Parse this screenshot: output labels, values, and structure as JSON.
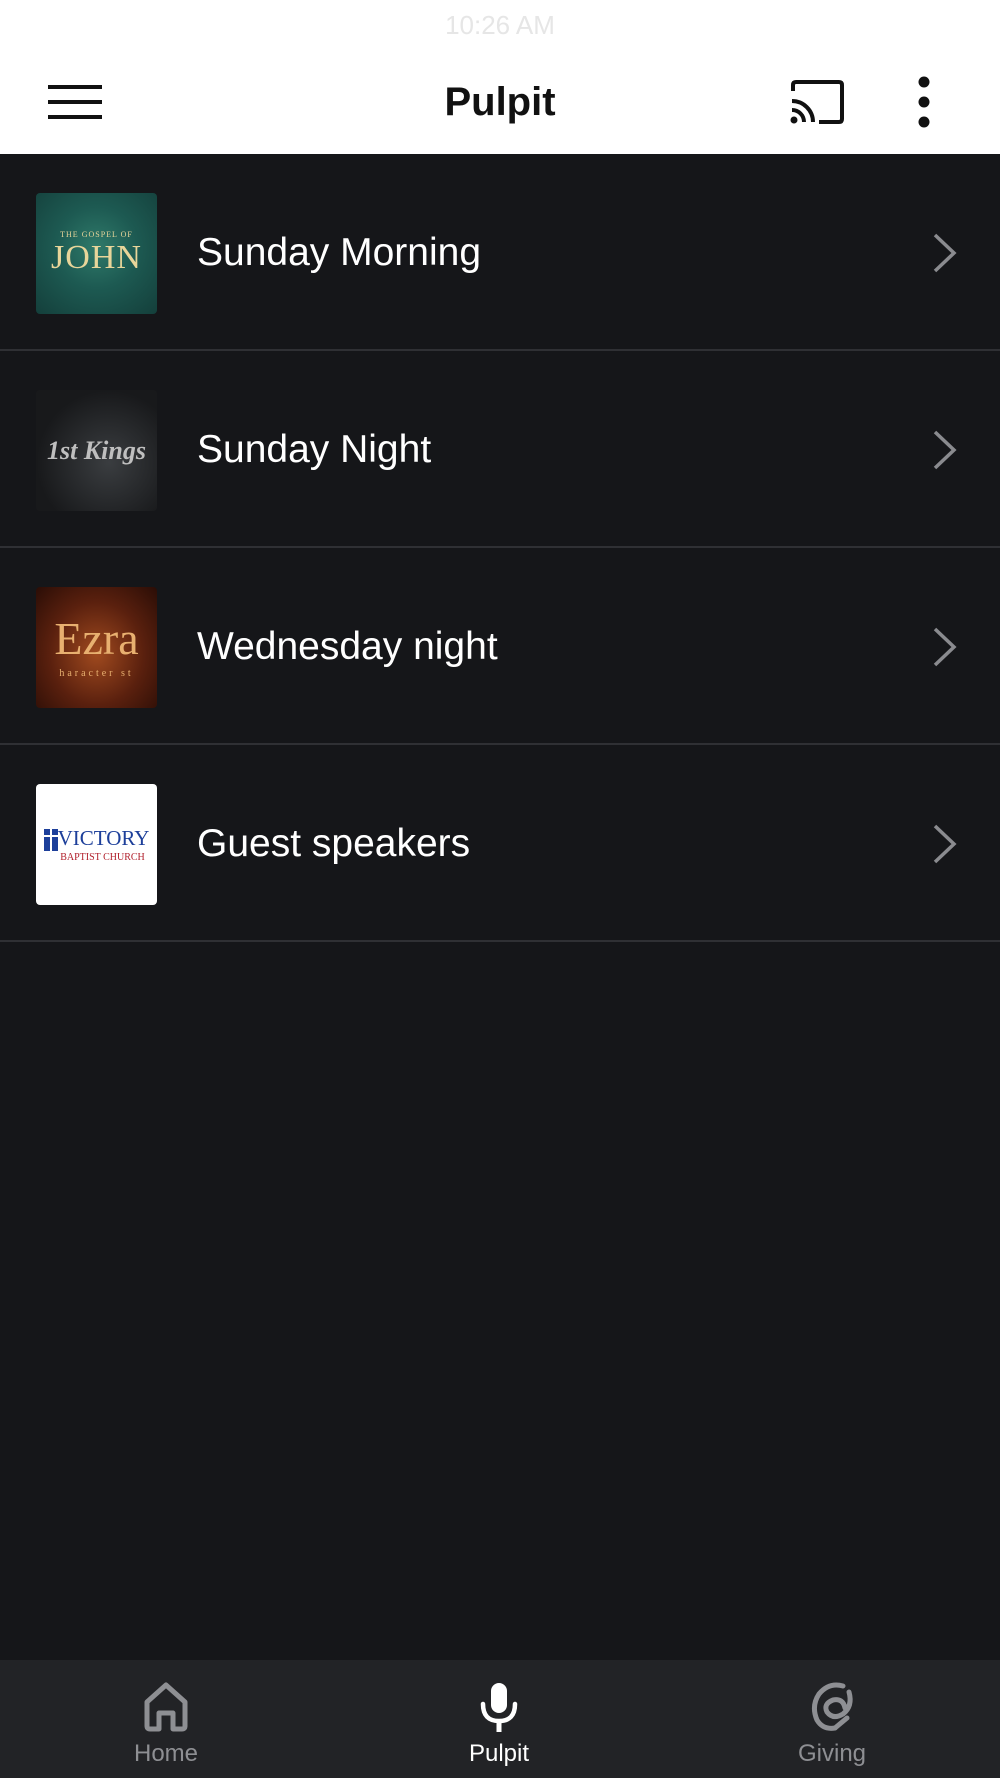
{
  "status_bar": {
    "time": "10:26 AM"
  },
  "header": {
    "title": "Pulpit"
  },
  "series": [
    {
      "label": "Sunday Morning",
      "thumb_top": "THE GOSPEL OF",
      "thumb_main": "JOHN"
    },
    {
      "label": "Sunday Night",
      "thumb_main": "1st Kings"
    },
    {
      "label": "Wednesday night",
      "thumb_main": "Ezra",
      "thumb_sub": "haracter st"
    },
    {
      "label": "Guest speakers",
      "thumb_main": "VICTORY",
      "thumb_sub": "BAPTIST CHURCH"
    }
  ],
  "tabs": [
    {
      "label": "Home",
      "icon": "home-icon",
      "active": false
    },
    {
      "label": "Pulpit",
      "icon": "microphone-icon",
      "active": true
    },
    {
      "label": "Giving",
      "icon": "giving-icon",
      "active": false
    }
  ],
  "colors": {
    "background": "#151619",
    "header": "#ffffff",
    "tab_bar": "#222326",
    "tab_active": "#ffffff",
    "tab_inactive": "#8e8f93",
    "chevron": "#8a8b8f"
  }
}
